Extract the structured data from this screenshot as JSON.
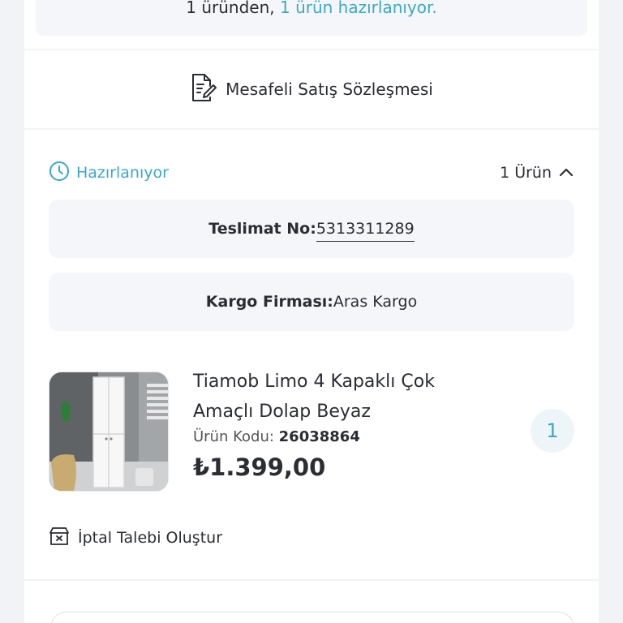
{
  "summary": {
    "prefix": "1 üründen, ",
    "highlight": "1 ürün hazırlanıyor."
  },
  "contract": {
    "label": "Mesafeli Satış Sözleşmesi",
    "icon": "document-edit-icon"
  },
  "order": {
    "status": "Hazırlanıyor",
    "status_icon": "clock-icon",
    "count_label": "1 Ürün",
    "toggle_icon": "chevron-up-icon",
    "delivery_label": "Teslimat No:",
    "delivery_value": "5313311289",
    "cargo_label": "Kargo Firması:",
    "cargo_value": "Aras Kargo",
    "product": {
      "name": "Tiamob Limo 4 Kapaklı Çok Amaçlı Dolap Beyaz",
      "code_label": "Ürün Kodu: ",
      "code_value": "26038864",
      "price": "₺1.399,00",
      "quantity": "1"
    },
    "cancel_label": "İptal Talebi Oluştur",
    "cancel_icon": "box-cancel-icon"
  },
  "colors": {
    "accent": "#3aa8c9",
    "text": "#2b2d33",
    "background": "#f2f3f6",
    "box": "#f5f6f9"
  }
}
